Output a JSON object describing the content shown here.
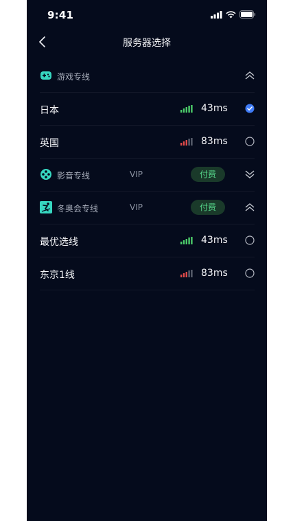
{
  "status": {
    "time": "9:41"
  },
  "nav": {
    "title": "服务器选择"
  },
  "colors": {
    "accent": "#3f7bf6",
    "good_signal": "#4ccc6a",
    "weak_signal": "#e04a4a",
    "pay_text": "#55d68a",
    "background": "#050b1c"
  },
  "groups": [
    {
      "label": "游戏专线",
      "icon": "gamepad-icon",
      "expanded": true,
      "servers": [
        {
          "name": "日本",
          "latency": "43ms",
          "signal": "good",
          "selected": true
        },
        {
          "name": "英国",
          "latency": "83ms",
          "signal": "weak",
          "selected": false
        }
      ]
    },
    {
      "label": "影音专线",
      "icon": "film-reel-icon",
      "vip": "VIP",
      "pay": "付费",
      "expanded": false
    },
    {
      "label": "冬奥会专线",
      "icon": "skier-icon",
      "vip": "VIP",
      "pay": "付费",
      "expanded": true,
      "servers": [
        {
          "name": "最优选线",
          "latency": "43ms",
          "signal": "good",
          "selected": false
        },
        {
          "name": "东京1线",
          "latency": "83ms",
          "signal": "weak",
          "selected": false
        }
      ]
    }
  ]
}
